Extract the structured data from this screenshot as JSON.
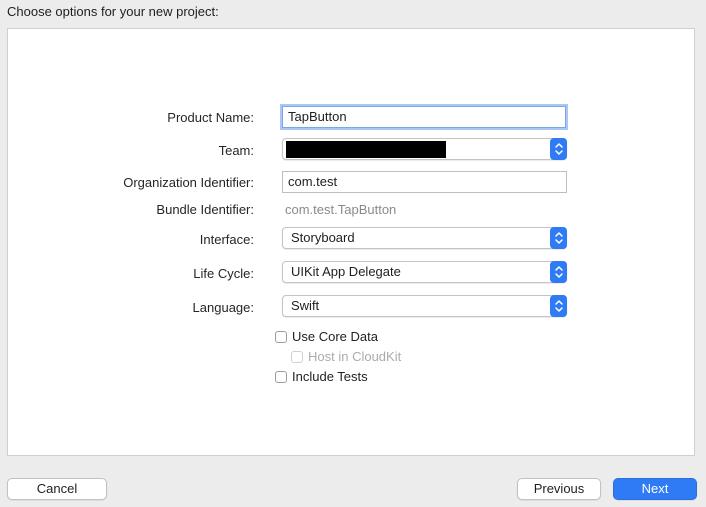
{
  "header": {
    "title": "Choose options for your new project:"
  },
  "form": {
    "product_name": {
      "label": "Product Name:",
      "value": "TapButton"
    },
    "team": {
      "label": "Team:",
      "value": ""
    },
    "organization_identifier": {
      "label": "Organization Identifier:",
      "value": "com.test"
    },
    "bundle_identifier": {
      "label": "Bundle Identifier:",
      "value": "com.test.TapButton"
    },
    "interface": {
      "label": "Interface:",
      "value": "Storyboard"
    },
    "life_cycle": {
      "label": "Life Cycle:",
      "value": "UIKit App Delegate"
    },
    "language": {
      "label": "Language:",
      "value": "Swift"
    },
    "use_core_data": {
      "label": "Use Core Data",
      "checked": false
    },
    "host_in_cloudkit": {
      "label": "Host in CloudKit",
      "checked": false,
      "enabled": false
    },
    "include_tests": {
      "label": "Include Tests",
      "checked": false
    }
  },
  "footer": {
    "cancel_label": "Cancel",
    "previous_label": "Previous",
    "next_label": "Next"
  },
  "colors": {
    "accent": "#2f7bf6",
    "focus_ring": "#a9c8f3",
    "panel_bg": "#ffffff",
    "window_bg": "#ececec"
  }
}
